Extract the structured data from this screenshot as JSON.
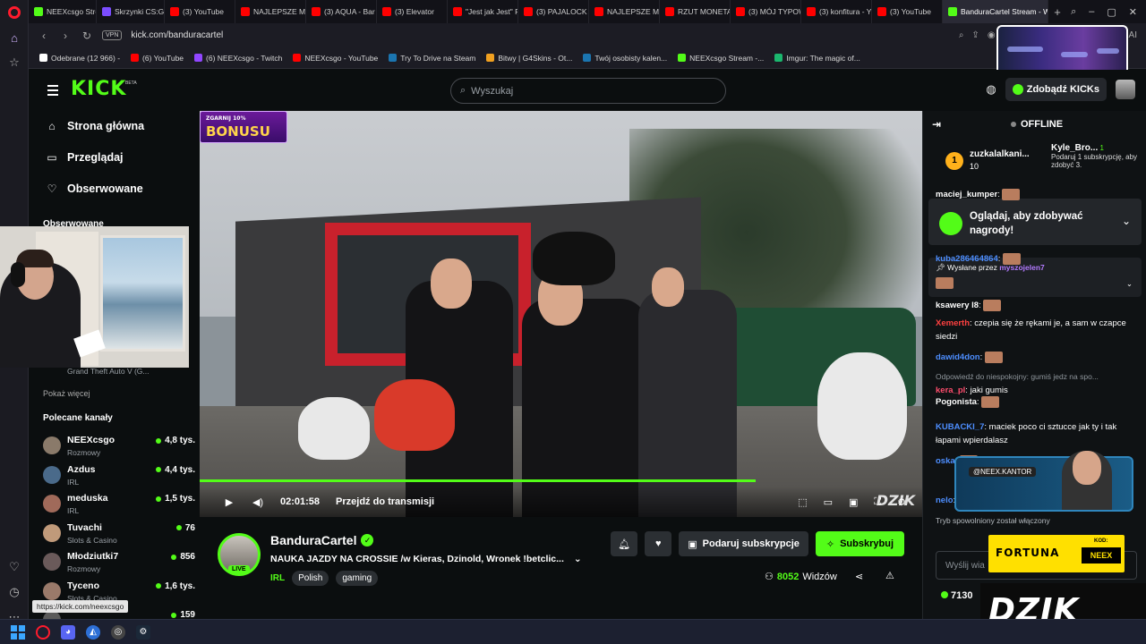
{
  "browser": {
    "tabs": [
      {
        "label": "NEEXcsgo Stre",
        "color": "#53fc18",
        "active": false
      },
      {
        "label": "Skrzynki CS:GO",
        "color": "#7b4dff",
        "active": false
      },
      {
        "label": "(3) YouTube",
        "color": "#ff0000",
        "active": false
      },
      {
        "label": "NAJLEPSZE MO",
        "color": "#ff0000",
        "active": false
      },
      {
        "label": "(3) AQUA - Bar",
        "color": "#ff0000",
        "active": false
      },
      {
        "label": "(3) Elevator",
        "color": "#ff0000",
        "active": false
      },
      {
        "label": "\"Jest jak Jest\" P",
        "color": "#ff0000",
        "active": false
      },
      {
        "label": "(3) PAJALOCK 2",
        "color": "#ff0000",
        "active": false
      },
      {
        "label": "NAJLEPSZE MO",
        "color": "#ff0000",
        "active": false
      },
      {
        "label": "RZUT MONETA",
        "color": "#ff0000",
        "active": false
      },
      {
        "label": "(3) MÓJ TYPOW",
        "color": "#ff0000",
        "active": false
      },
      {
        "label": "(3) konfitura - Y",
        "color": "#ff0000",
        "active": false
      },
      {
        "label": "(3) YouTube",
        "color": "#ff0000",
        "active": false
      },
      {
        "label": "BanduraCartel Stream - W",
        "color": "#53fc18",
        "active": true
      }
    ],
    "new_tab": "+",
    "vpn": "VPN",
    "url": "kick.com/banduracartel",
    "ai_label": "AI",
    "bookmarks": [
      {
        "label": "Odebrane (12 966) -",
        "color": "#ffffff"
      },
      {
        "label": "(6) YouTube",
        "color": "#ff0000"
      },
      {
        "label": "(6) NEEXcsgo - Twitch",
        "color": "#9146ff"
      },
      {
        "label": "NEEXcsgo - YouTube",
        "color": "#ff0000"
      },
      {
        "label": "Try To Drive na Steam",
        "color": "#1b75b0"
      },
      {
        "label": "Bitwy | G4Skins - Ot...",
        "color": "#f0a020"
      },
      {
        "label": "Twój osobisty kalen...",
        "color": "#1b75b0"
      },
      {
        "label": "NEEXcsgo Stream -...",
        "color": "#53fc18"
      },
      {
        "label": "Imgur: The magic of...",
        "color": "#1bb76e"
      }
    ]
  },
  "kick": {
    "logo": "KICK",
    "beta": "BETA",
    "search_placeholder": "Wyszukaj",
    "get_kicks": "Zdobądź KICKs"
  },
  "sidebar": {
    "nav": [
      {
        "label": "Strona główna",
        "icon": "home-icon"
      },
      {
        "label": "Przeglądaj",
        "icon": "browse-icon"
      },
      {
        "label": "Obserwowane",
        "icon": "heart-icon"
      }
    ],
    "followed_title": "Obserwowane",
    "hidden_followed_category": "Grand Theft Auto V (G...",
    "show_more": "Pokaż więcej",
    "recommended_title": "Polecane kanały",
    "channels": [
      {
        "name": "NEEXcsgo",
        "category": "Rozmowy",
        "viewers": "4,8 tys.",
        "avatar": "#8a7a6a"
      },
      {
        "name": "Azdus",
        "category": "IRL",
        "viewers": "4,4 tys.",
        "avatar": "#4a6a8a"
      },
      {
        "name": "meduska",
        "category": "IRL",
        "viewers": "1,5 tys.",
        "avatar": "#a06a5a"
      },
      {
        "name": "Tuvachi",
        "category": "Slots & Casino",
        "viewers": "76",
        "avatar": "#c09a7a"
      },
      {
        "name": "Młodziutki7",
        "category": "Rozmowy",
        "viewers": "856",
        "avatar": "#6a5a5a"
      },
      {
        "name": "Tyceno",
        "category": "Slots & Casino",
        "viewers": "1,6 tys.",
        "avatar": "#9a7a6a"
      },
      {
        "name": "",
        "category": "",
        "viewers": "159",
        "avatar": "#5a5a5a"
      }
    ]
  },
  "player": {
    "promo_top": "ZGARNIJ 10%",
    "promo_main": "BONUSU",
    "time": "02:01:58",
    "go_live": "Przejdź do transmisji",
    "watermark": "DZIK",
    "progress": 0.77
  },
  "stream": {
    "live_badge": "LIVE",
    "channel": "BanduraCartel",
    "title": "NAUKA JAZDY NA CROSSIE /w Kieras, Dzinold, Wronek !betclic...",
    "category": "IRL",
    "tags": [
      "Polish",
      "gaming"
    ],
    "gift_label": "Podaruj subskrypcje",
    "subscribe_label": "Subskrybuj",
    "viewers_count": "8052",
    "viewers_label": "Widzów"
  },
  "chat": {
    "status": "OFFLINE",
    "leader": {
      "rank": "1",
      "name": "zuzkalalkani...",
      "count": "10"
    },
    "gift": {
      "name": "Kyle_Bro...",
      "count": "1",
      "text": "Podaruj 1 subskrypcję, aby zdobyć 3."
    },
    "rewards_text": "Oglądaj, aby zdobywać nagrody!",
    "pinned_by": "Wysłane przez",
    "pinned_user": "myszojelen7",
    "messages": [
      {
        "user": "maciej_kumper",
        "color": "#ffffff",
        "text": "",
        "reply": ""
      },
      {
        "user": "kuba286464864",
        "color": "#4d8eff",
        "text": "",
        "reply": ""
      },
      {
        "user": "ksawery l8",
        "color": "#ffffff",
        "text": "",
        "reply": ""
      },
      {
        "user": "Xemerth",
        "color": "#ff4040",
        "text": "czepia się że rękami je, a sam w czapce siedzi",
        "reply": ""
      },
      {
        "user": "dawid4don",
        "color": "#4d8eff",
        "text": "",
        "reply": ""
      },
      {
        "user": "kera_pl",
        "color": "#ff4d6d",
        "text": "jaki gumis",
        "reply": "Odpowiedź do niespokojny: gumiś jedz na spo..."
      },
      {
        "user": "Pogonista",
        "color": "#ffffff",
        "text": "",
        "reply": ""
      },
      {
        "user": "KUBACKI_7",
        "color": "#4d8eff",
        "text": "maciek poco ci sztucce jak ty i tak łapami wpierdalasz",
        "reply": ""
      },
      {
        "user": "oska",
        "color": "#4d8eff",
        "text": "",
        "reply": ""
      },
      {
        "user": "nelo",
        "color": "#4d8eff",
        "text": "",
        "reply": ""
      }
    ],
    "slow_mode": "Tryb spowolniony został włączony",
    "input_placeholder": "Wyślij wia",
    "kicks_count": "7130"
  },
  "overlays": {
    "ig_handle": "@NEEX.KANTOR",
    "fortuna": "FORTUNA",
    "fortuna_code_label": "KOD:",
    "fortuna_code": "NEEX",
    "dzik": "DZIK"
  },
  "status_url": "https://kick.com/neexcsgo",
  "accent": "#53fc18"
}
